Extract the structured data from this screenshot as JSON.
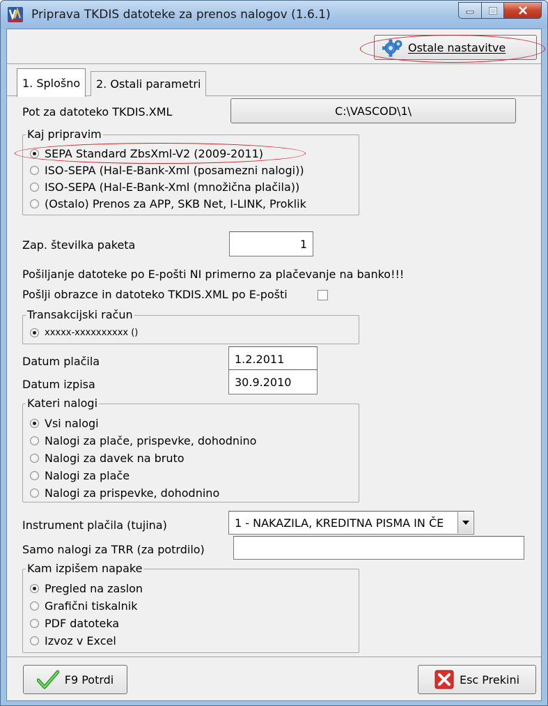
{
  "window": {
    "title": "Priprava TKDIS datoteke za prenos nalogov  (1.6.1)"
  },
  "toolbar": {
    "settings_label": "Ostale nastavitve"
  },
  "tabs": [
    {
      "label": "1. Splošno"
    },
    {
      "label": "2. Ostali parametri"
    }
  ],
  "path": {
    "label": "Pot za datoteko TKDIS.XML",
    "value": "C:\\VASCOD\\1\\"
  },
  "kaj_pripravim": {
    "title": "Kaj pripravim",
    "options": [
      {
        "label": "SEPA Standard ZbsXml-V2 (2009-2011)",
        "selected": true
      },
      {
        "label": "ISO-SEPA (Hal-E-Bank-Xml (posamezni nalogi))",
        "selected": false
      },
      {
        "label": "ISO-SEPA (Hal-E-Bank-Xml (množična plačila))",
        "selected": false
      },
      {
        "label": "(Ostalo) Prenos za APP, SKB Net, I-LINK, Proklik",
        "selected": false
      }
    ]
  },
  "paket": {
    "label": "Zap. številka paketa",
    "value": "1"
  },
  "email": {
    "warning": "Pošiljanje datoteke po E-pošti NI primerno za plačevanje na banko!!!",
    "send_label": "Pošlji obrazce in datoteko TKDIS.XML po E-pošti",
    "checked": false
  },
  "racun": {
    "title": "Transakcijski račun",
    "option": "xxxxx-xxxxxxxxxx ()"
  },
  "datum_placila": {
    "label": "Datum plačila",
    "value": "1.2.2011"
  },
  "datum_izpisa": {
    "label": "Datum izpisa",
    "value": "30.9.2010"
  },
  "kateri_nalogi": {
    "title": "Kateri nalogi",
    "options": [
      {
        "label": "Vsi nalogi",
        "selected": true
      },
      {
        "label": "Nalogi za plače, prispevke, dohodnino",
        "selected": false
      },
      {
        "label": "Nalogi za davek na bruto",
        "selected": false
      },
      {
        "label": "Nalogi za plače",
        "selected": false
      },
      {
        "label": "Nalogi za prispevke, dohodnino",
        "selected": false
      }
    ]
  },
  "instrument": {
    "label": "Instrument plačila (tujina)",
    "value": "1 - NAKAZILA, KREDITNA PISMA IN ČE"
  },
  "trr": {
    "label": "Samo nalogi za TRR (za potrdilo)",
    "value": ""
  },
  "napake": {
    "title": "Kam izpišem napake",
    "options": [
      {
        "label": "Pregled na zaslon",
        "selected": true
      },
      {
        "label": "Grafični tiskalnik",
        "selected": false
      },
      {
        "label": "PDF datoteka",
        "selected": false
      },
      {
        "label": "Izvoz v Excel",
        "selected": false
      }
    ]
  },
  "footer": {
    "confirm_label": "F9 Potrdi",
    "cancel_label": "Esc Prekini"
  }
}
